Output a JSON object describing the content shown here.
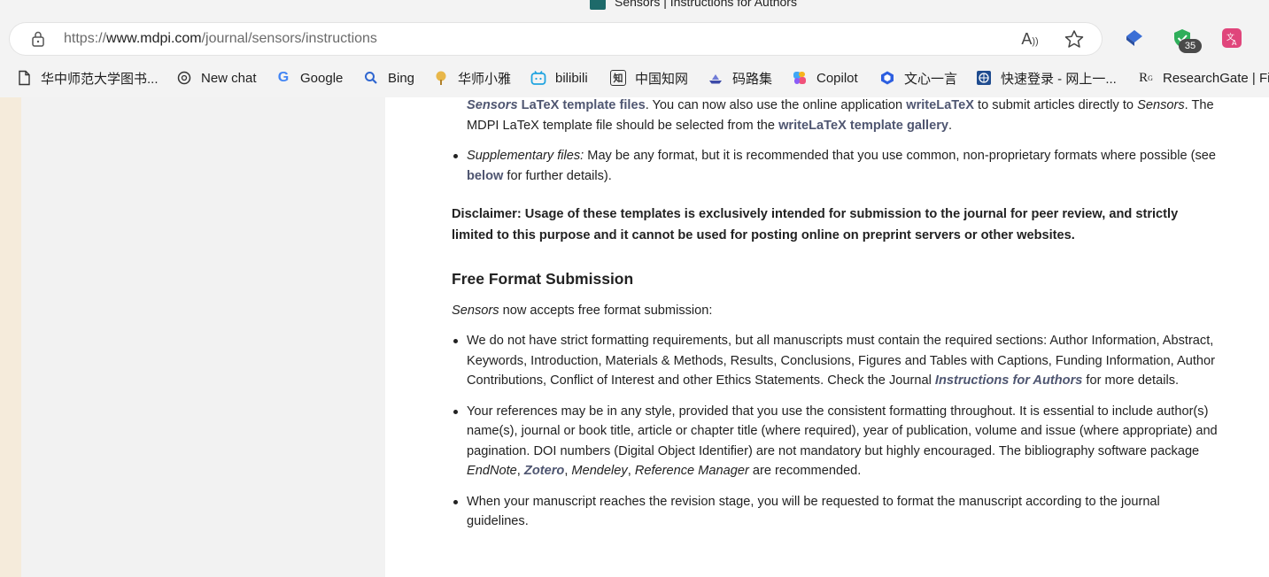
{
  "browser": {
    "tab_title": "Sensors | Instructions for Authors",
    "url_prefix": "https://",
    "url_host": "www.mdpi.com",
    "url_path": "/journal/sensors/instructions",
    "extension_badge": "35",
    "icons": [
      "lock-icon",
      "read-aloud-icon",
      "favorite-star-icon",
      "extension-icon"
    ]
  },
  "bookmarks": [
    {
      "label": "华中师范大学图书...",
      "icon": "document-icon"
    },
    {
      "label": "New chat",
      "icon": "openai-icon"
    },
    {
      "label": "Google",
      "icon": "google-icon"
    },
    {
      "label": "Bing",
      "icon": "search-icon"
    },
    {
      "label": "华师小雅",
      "icon": "tree-icon"
    },
    {
      "label": "bilibili",
      "icon": "bilibili-icon"
    },
    {
      "label": "中国知网",
      "icon": "cnki-icon"
    },
    {
      "label": "码路集",
      "icon": "ship-icon"
    },
    {
      "label": "Copilot",
      "icon": "copilot-icon"
    },
    {
      "label": "文心一言",
      "icon": "wenxin-icon"
    },
    {
      "label": "快速登录 - 网上一...",
      "icon": "globe-icon"
    },
    {
      "label": "ResearchGate | Fin",
      "icon": "researchgate-icon"
    }
  ],
  "content": {
    "latex_item": {
      "link1_italic": "Sensors",
      "link1_rest": " LaTeX template files",
      "text1": ". You can now also use the online application ",
      "link2": "writeLaTeX",
      "text2": " to submit articles directly to ",
      "journal_italic": "Sensors",
      "text3": ". The MDPI LaTeX template file should be selected from the ",
      "link3": "writeLaTeX template gallery",
      "text4": "."
    },
    "supp_item": {
      "label": "Supplementary files:",
      "text1": " May be any format, but it is recommended that you use common, non-proprietary formats where possible (see ",
      "link": "below",
      "text2": " for further details)."
    },
    "disclaimer": "Disclaimer: Usage of these templates is exclusively intended for submission to the journal for peer review, and strictly limited to this purpose and it cannot be used for posting online on preprint servers or other websites.",
    "heading": "Free Format Submission",
    "intro_italic": "Sensors",
    "intro_rest": " now accepts free format submission:",
    "bullet1": {
      "text": "We do not have strict formatting requirements, but all manuscripts must contain the required sections: Author Information, Abstract, Keywords, Introduction, Materials & Methods, Results, Conclusions, Figures and Tables with Captions, Funding Information, Author Contributions, Conflict of Interest and other Ethics Statements. Check the Journal ",
      "link": "Instructions for Authors",
      "text_after": " for more details."
    },
    "bullet2": {
      "text": "Your references may be in any style, provided that you use the consistent formatting throughout. It is essential to include author(s) name(s), journal or book title, article or chapter title (where required), year of publication, volume and issue (where appropriate) and pagination. DOI numbers (Digital Object Identifier) are not mandatory but highly encouraged. The bibliography software package ",
      "endnote": "EndNote",
      "sep1": ", ",
      "zotero": "Zotero",
      "sep2": ", ",
      "mendeley": "Mendeley",
      "sep3": ", ",
      "refman": "Reference Manager",
      "text_after": " are recommended."
    },
    "bullet3": "When your manuscript reaches the revision stage, you will be requested to format the manuscript according to the journal guidelines."
  }
}
